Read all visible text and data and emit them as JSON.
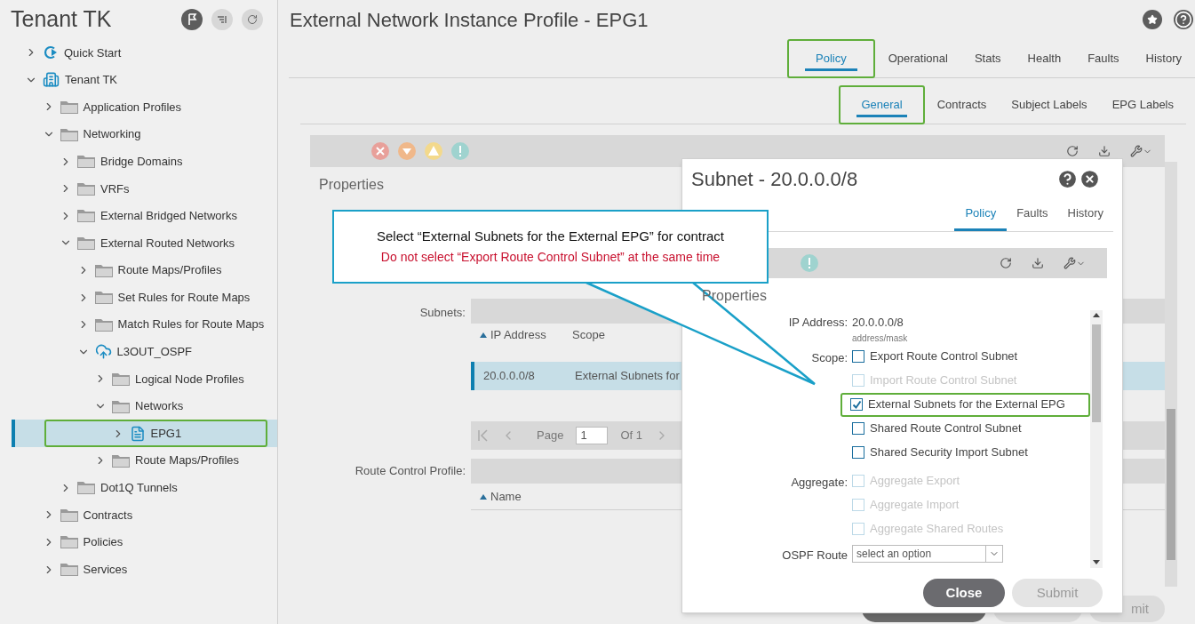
{
  "sidebar": {
    "title": "Tenant TK",
    "tree": [
      {
        "label": "Quick Start",
        "kind": "quickstart",
        "expanded": false,
        "selected": false
      },
      {
        "label": "Tenant TK",
        "kind": "tenant",
        "expanded": true,
        "selected": false,
        "children": [
          {
            "label": "Application Profiles",
            "kind": "folder",
            "expanded": false,
            "selected": false
          },
          {
            "label": "Networking",
            "kind": "folder",
            "expanded": true,
            "selected": false,
            "children": [
              {
                "label": "Bridge Domains",
                "kind": "folder",
                "expanded": false,
                "selected": false
              },
              {
                "label": "VRFs",
                "kind": "folder",
                "expanded": false,
                "selected": false
              },
              {
                "label": "External Bridged Networks",
                "kind": "folder",
                "expanded": false,
                "selected": false
              },
              {
                "label": "External Routed Networks",
                "kind": "folder",
                "expanded": true,
                "selected": false,
                "children": [
                  {
                    "label": "Route Maps/Profiles",
                    "kind": "folder",
                    "expanded": false,
                    "selected": false
                  },
                  {
                    "label": "Set Rules for Route Maps",
                    "kind": "folder",
                    "expanded": false,
                    "selected": false
                  },
                  {
                    "label": "Match Rules for Route Maps",
                    "kind": "folder",
                    "expanded": false,
                    "selected": false
                  },
                  {
                    "label": "L3OUT_OSPF",
                    "kind": "cloud",
                    "expanded": true,
                    "selected": false,
                    "children": [
                      {
                        "label": "Logical Node Profiles",
                        "kind": "folder",
                        "expanded": false,
                        "selected": false
                      },
                      {
                        "label": "Networks",
                        "kind": "folder",
                        "expanded": true,
                        "selected": false,
                        "children": [
                          {
                            "label": "EPG1",
                            "kind": "epg",
                            "expanded": false,
                            "selected": true,
                            "highlighted": true
                          }
                        ]
                      },
                      {
                        "label": "Route Maps/Profiles",
                        "kind": "folder",
                        "expanded": false,
                        "selected": false
                      }
                    ]
                  }
                ]
              },
              {
                "label": "Dot1Q Tunnels",
                "kind": "folder",
                "expanded": false,
                "selected": false
              }
            ]
          },
          {
            "label": "Contracts",
            "kind": "folder",
            "expanded": false,
            "selected": false
          },
          {
            "label": "Policies",
            "kind": "folder",
            "expanded": false,
            "selected": false
          },
          {
            "label": "Services",
            "kind": "folder",
            "expanded": false,
            "selected": false
          }
        ]
      }
    ]
  },
  "page": {
    "title": "External Network Instance Profile - EPG1",
    "tabs": [
      {
        "label": "Policy",
        "selected": true,
        "highlighted": true
      },
      {
        "label": "Operational",
        "selected": false
      },
      {
        "label": "Stats",
        "selected": false
      },
      {
        "label": "Health",
        "selected": false
      },
      {
        "label": "Faults",
        "selected": false
      },
      {
        "label": "History",
        "selected": false
      }
    ],
    "subtabs": [
      {
        "label": "General",
        "selected": true,
        "highlighted": true
      },
      {
        "label": "Contracts",
        "selected": false
      },
      {
        "label": "Subject Labels",
        "selected": false
      },
      {
        "label": "EPG Labels",
        "selected": false
      }
    ],
    "section": "Properties",
    "subnets": {
      "label": "Subnets:",
      "columns": [
        "IP Address",
        "Scope"
      ],
      "rows": [
        {
          "ip": "20.0.0.0/8",
          "scope": "External Subnets for",
          "selected": true
        }
      ],
      "pager": {
        "page_label": "Page",
        "page": "1",
        "of": "Of 1"
      }
    },
    "route_control": {
      "label": "Route Control Profile:",
      "columns": [
        "Name"
      ]
    },
    "footer_button": "mit"
  },
  "modal": {
    "title": "Subnet - 20.0.0.0/8",
    "tabs": [
      {
        "label": "Policy",
        "selected": true
      },
      {
        "label": "Faults",
        "selected": false
      },
      {
        "label": "History",
        "selected": false
      }
    ],
    "section": "Properties",
    "ip_label": "IP Address:",
    "ip_value": "20.0.0.0/8",
    "ip_hint": "address/mask",
    "scope_label": "Scope:",
    "scope": [
      {
        "label": "Export Route Control Subnet",
        "checked": false,
        "disabled": false
      },
      {
        "label": "Import Route Control Subnet",
        "checked": false,
        "disabled": true
      },
      {
        "label": "External Subnets for the External EPG",
        "checked": true,
        "disabled": false,
        "highlighted": true
      },
      {
        "label": "Shared Route Control Subnet",
        "checked": false,
        "disabled": false
      },
      {
        "label": "Shared Security Import Subnet",
        "checked": false,
        "disabled": false
      }
    ],
    "aggregate_label": "Aggregate:",
    "aggregate": [
      {
        "label": "Aggregate Export",
        "checked": false,
        "disabled": true
      },
      {
        "label": "Aggregate Import",
        "checked": false,
        "disabled": true
      },
      {
        "label": "Aggregate Shared Routes",
        "checked": false,
        "disabled": true
      }
    ],
    "ospf_label": "OSPF Route",
    "ospf_placeholder": "select an option",
    "buttons": [
      {
        "label": "Close",
        "kind": "primary"
      },
      {
        "label": "Submit",
        "kind": "secondary"
      }
    ]
  },
  "callout": {
    "lines": [
      {
        "text": "Select “External Subnets for the External EPG” for contract",
        "kind": "note"
      },
      {
        "text": "Do not select “Export Route Control Subnet” at the same time",
        "kind": "warning"
      }
    ]
  }
}
